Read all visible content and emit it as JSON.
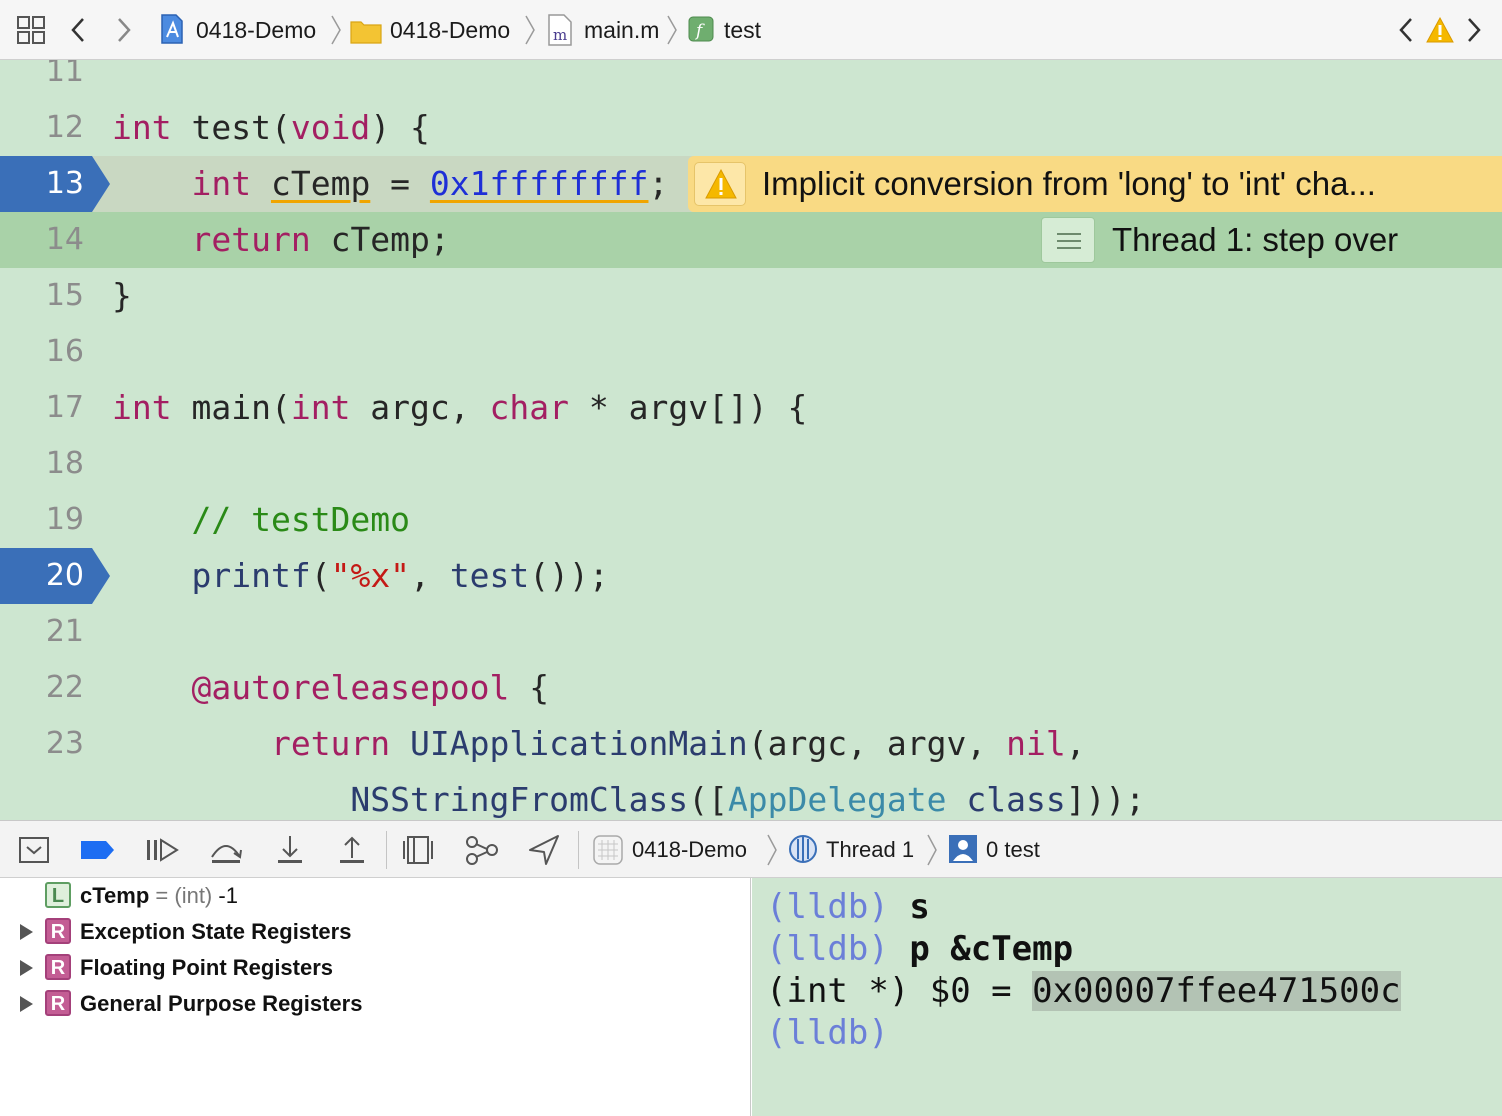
{
  "jumpbar": {
    "crumbs": [
      {
        "label": "0418-Demo",
        "icon": "xcode-project-icon"
      },
      {
        "label": "0418-Demo",
        "icon": "folder-icon"
      },
      {
        "label": "main.m",
        "icon": "objc-file-icon"
      },
      {
        "label": "test",
        "icon": "function-icon"
      }
    ],
    "icons": [
      "related-items-icon",
      "back-icon",
      "forward-icon",
      "previous-issue-icon",
      "warning-icon",
      "next-issue-icon"
    ]
  },
  "editor": {
    "lines": [
      {
        "n": "11"
      },
      {
        "n": "12",
        "tokens": [
          [
            "kw",
            "int"
          ],
          [
            "p",
            " test("
          ],
          [
            "kw",
            "void"
          ],
          [
            "p",
            ") {"
          ]
        ]
      },
      {
        "n": "13",
        "tokens": [
          [
            "p",
            "    "
          ],
          [
            "kw",
            "int"
          ],
          [
            "p",
            " "
          ],
          [
            "u",
            "cTemp"
          ],
          [
            "p",
            " = "
          ],
          [
            "num",
            "0x1ffffffff"
          ],
          [
            "p",
            ";"
          ]
        ]
      },
      {
        "n": "14",
        "tokens": [
          [
            "p",
            "    "
          ],
          [
            "kw",
            "return"
          ],
          [
            "p",
            " cTemp;"
          ]
        ]
      },
      {
        "n": "15",
        "tokens": [
          [
            "p",
            "}"
          ]
        ]
      },
      {
        "n": "16"
      },
      {
        "n": "17",
        "tokens": [
          [
            "kw",
            "int"
          ],
          [
            "p",
            " main("
          ],
          [
            "kw",
            "int"
          ],
          [
            "p",
            " argc, "
          ],
          [
            "kw",
            "char"
          ],
          [
            "p",
            " * argv[]) {"
          ]
        ]
      },
      {
        "n": "18"
      },
      {
        "n": "19",
        "tokens": [
          [
            "p",
            "    "
          ],
          [
            "cm",
            "// testDemo"
          ]
        ]
      },
      {
        "n": "20",
        "tokens": [
          [
            "p",
            "    "
          ],
          [
            "fn",
            "printf"
          ],
          [
            "p",
            "("
          ],
          [
            "str",
            "\"%x\""
          ],
          [
            "p",
            ", "
          ],
          [
            "fn",
            "test"
          ],
          [
            "p",
            "());"
          ]
        ]
      },
      {
        "n": "21"
      },
      {
        "n": "22",
        "tokens": [
          [
            "p",
            "    "
          ],
          [
            "kw",
            "@autoreleasepool"
          ],
          [
            "p",
            " {"
          ]
        ]
      },
      {
        "n": "23",
        "tokens": [
          [
            "p",
            "        "
          ],
          [
            "kw",
            "return"
          ],
          [
            "p",
            " "
          ],
          [
            "fn",
            "UIApplicationMain"
          ],
          [
            "p",
            "(argc, argv, "
          ],
          [
            "kw",
            "nil"
          ],
          [
            "p",
            ","
          ]
        ]
      },
      {
        "n": "",
        "tokens": [
          [
            "p",
            "            "
          ],
          [
            "fn",
            "NSStringFromClass"
          ],
          [
            "p",
            "(["
          ],
          [
            "cls",
            "AppDelegate"
          ],
          [
            "p",
            " "
          ],
          [
            "fn",
            "class"
          ],
          [
            "p",
            "]));"
          ]
        ]
      }
    ],
    "breakpoint_lines": [
      "13",
      "20"
    ],
    "warning_text": "Implicit conversion from 'long' to 'int' cha...",
    "thread_status": "Thread 1: step over"
  },
  "debugbar": {
    "buttons": [
      "hide-debug-area-icon",
      "breakpoints-toggle-icon",
      "continue-icon",
      "step-over-icon",
      "step-into-icon",
      "step-out-icon",
      "view-debugger-icon",
      "memory-graph-icon",
      "simulate-location-icon"
    ],
    "crumbs": [
      {
        "label": "0418-Demo",
        "icon": "app-icon"
      },
      {
        "label": "Thread 1",
        "icon": "thread-icon"
      },
      {
        "label": "0 test",
        "icon": "frame-icon"
      }
    ]
  },
  "variables": [
    {
      "badge": "L",
      "name": "cTemp",
      "type": "(int)",
      "value": "-1",
      "expandable": false
    },
    {
      "badge": "R",
      "name": "Exception State Registers",
      "expandable": true
    },
    {
      "badge": "R",
      "name": "Floating Point Registers",
      "expandable": true
    },
    {
      "badge": "R",
      "name": "General Purpose Registers",
      "expandable": true
    }
  ],
  "console": {
    "prompt": "(lldb)",
    "lines": [
      {
        "prompt": true,
        "text": "s"
      },
      {
        "prompt": true,
        "text": "p &cTemp"
      },
      {
        "prompt": false,
        "prefix": "(int *) $0 = ",
        "highlight": "0x00007ffee471500c"
      },
      {
        "prompt": true,
        "text": ""
      }
    ]
  },
  "colors": {
    "editor_bg": "#cde6d0",
    "exec_line": "#a9d2a8",
    "breakpoint": "#3a6fb8",
    "warning": "#f9da84",
    "keyword": "#a31f62",
    "number": "#1e2fd7",
    "string": "#c41a16",
    "comment": "#2a8a17",
    "lldb_prompt": "#6b7fd8"
  }
}
